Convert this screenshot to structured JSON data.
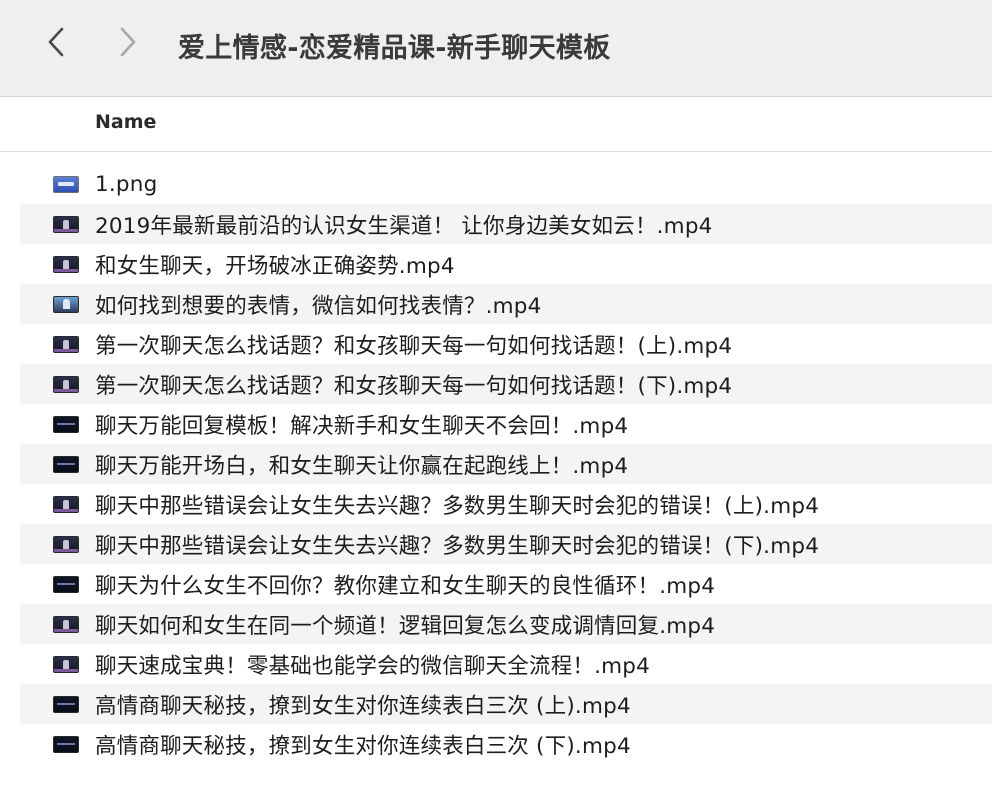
{
  "window": {
    "title": "爱上情感-恋爱精品课-新手聊天模板"
  },
  "toolbar": {
    "back_icon": "chevron-left-icon",
    "forward_icon": "chevron-right-icon"
  },
  "columns": {
    "name_label": "Name"
  },
  "files": [
    {
      "name": "1.png",
      "icon": "image"
    },
    {
      "name": "2019年最新最前沿的认识女生渠道！ 让你身边美女如云！.mp4",
      "icon": "video"
    },
    {
      "name": "和女生聊天，开场破冰正确姿势.mp4",
      "icon": "video"
    },
    {
      "name": "如何找到想要的表情，微信如何找表情？.mp4",
      "icon": "image-light"
    },
    {
      "name": "第一次聊天怎么找话题？和女孩聊天每一句如何找话题！(上).mp4",
      "icon": "video"
    },
    {
      "name": "第一次聊天怎么找话题？和女孩聊天每一句如何找话题！(下).mp4",
      "icon": "video"
    },
    {
      "name": "聊天万能回复模板！解决新手和女生聊天不会回！.mp4",
      "icon": "dark"
    },
    {
      "name": "聊天万能开场白，和女生聊天让你赢在起跑线上！.mp4",
      "icon": "dark"
    },
    {
      "name": "聊天中那些错误会让女生失去兴趣？多数男生聊天时会犯的错误！(上).mp4",
      "icon": "video"
    },
    {
      "name": "聊天中那些错误会让女生失去兴趣？多数男生聊天时会犯的错误！(下).mp4",
      "icon": "video"
    },
    {
      "name": "聊天为什么女生不回你？教你建立和女生聊天的良性循环！.mp4",
      "icon": "dark"
    },
    {
      "name": "聊天如何和女生在同一个频道！逻辑回复怎么变成调情回复.mp4",
      "icon": "video"
    },
    {
      "name": "聊天速成宝典！零基础也能学会的微信聊天全流程！.mp4",
      "icon": "video"
    },
    {
      "name": "高情商聊天秘技，撩到女生对你连续表白三次 (上).mp4",
      "icon": "dark"
    },
    {
      "name": "高情商聊天秘技，撩到女生对你连续表白三次 (下).mp4",
      "icon": "dark"
    }
  ]
}
